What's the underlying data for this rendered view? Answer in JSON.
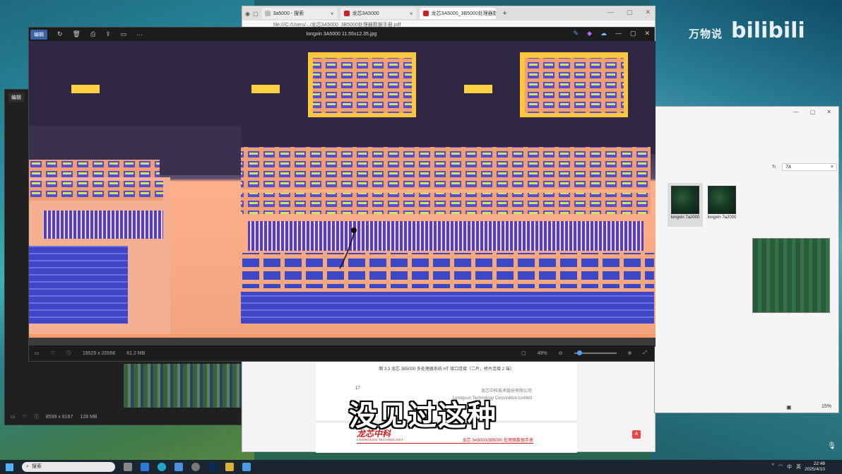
{
  "watermark": {
    "author": "万物说",
    "brand": "bilibili"
  },
  "browser": {
    "tabs": [
      {
        "label": "3a5000 - 搜索",
        "color": "#ffffff"
      },
      {
        "label": "龙芯3A5000",
        "color": "#d02020"
      },
      {
        "label": "龙芯3A5000_3B5000处理器数据手",
        "color": "#d02020"
      }
    ],
    "address": "file:///C:/Users/.../龙芯3A5000_3B5000处理器数据手册.pdf",
    "pdf": {
      "caption": "图 3.3  龙芯 3B5000 多处理器系统 HT 接口连接（二片，桥片连接 2 端）",
      "page_number": "17",
      "company_cn": "龙芯中科技术股份有限公司",
      "company_en": "Loongson Technology Corporation Limited",
      "logo": "龙芯中科",
      "logo_sub": "LOONGSON TECHNOLOGY",
      "doc_title": "龙芯 3A5000/3B5000 处理器数据手册"
    }
  },
  "explorer": {
    "search_value": "7a",
    "files": [
      {
        "name": "longxin 7a2000"
      },
      {
        "name": "longxin 7a2000"
      }
    ],
    "zoom": "15%"
  },
  "photos_back": {
    "edit_label": "编辑",
    "dimensions": "8599 x 8167",
    "size": "128 MB"
  },
  "photos": {
    "edit_label": "编辑",
    "title": "longxin 3A5000 11.55x12.35.jpg",
    "dimensions": "19525 x 20566",
    "size": "61.2 MB",
    "zoom": "49%"
  },
  "subtitle": "没见过这种",
  "taskbar": {
    "search_label": "搜索",
    "time": "22:48",
    "date": "2025/4/10",
    "ime": "中",
    "lang": "英"
  }
}
